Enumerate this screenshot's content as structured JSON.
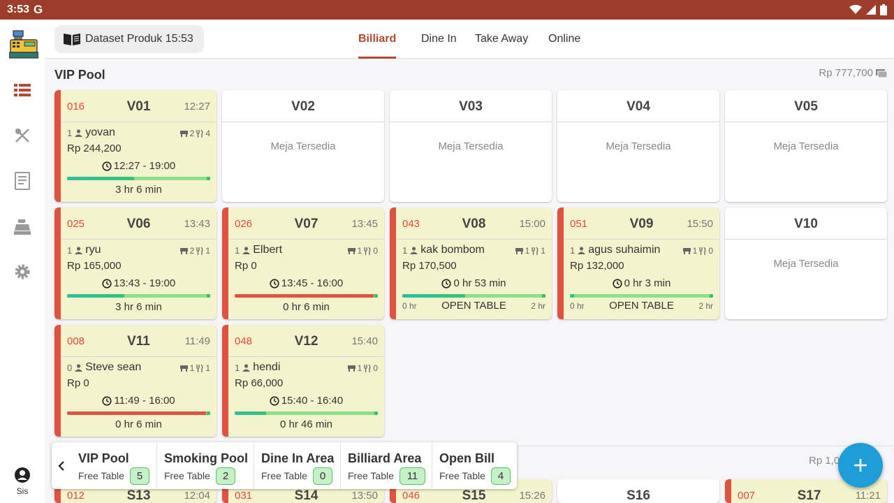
{
  "status_bar": {
    "time": "3:53",
    "g_icon": "G"
  },
  "sidebar": {
    "items": [
      {
        "icon": "list-icon"
      },
      {
        "icon": "utensils-icon"
      },
      {
        "icon": "receipt-icon"
      },
      {
        "icon": "cash-register-icon"
      },
      {
        "icon": "gear-icon"
      }
    ],
    "user_label": "Sis"
  },
  "topbar": {
    "dataset_label": "Dataset Produk 15:53",
    "tabs": [
      "Billiard",
      "Dine In",
      "Take Away",
      "Online"
    ],
    "active_tab": "Billiard"
  },
  "vip": {
    "title": "VIP Pool",
    "total": "Rp 777,700",
    "tables": [
      {
        "name": "V01",
        "bill": "016",
        "start": "12:27",
        "guests": "1",
        "customer": "yovan",
        "tables_count": "2",
        "items": "4",
        "amount": "Rp 244,200",
        "period": "12:27 - 19:00",
        "duration": "3 hr 6 min",
        "progress": 0.47
      },
      {
        "name": "V02",
        "available": "Meja Tersedia"
      },
      {
        "name": "V03",
        "available": "Meja Tersedia"
      },
      {
        "name": "V04",
        "available": "Meja Tersedia"
      },
      {
        "name": "V05",
        "available": "Meja Tersedia"
      },
      {
        "name": "V06",
        "bill": "025",
        "start": "13:43",
        "guests": "1",
        "customer": "ryu",
        "tables_count": "2",
        "items": "1",
        "amount": "Rp 165,000",
        "period": "13:43 - 19:00",
        "duration": "3 hr 6 min",
        "progress": 0.4
      },
      {
        "name": "V07",
        "bill": "026",
        "start": "13:45",
        "guests": "1",
        "customer": "Elbert",
        "tables_count": "1",
        "items": "0",
        "amount": "Rp 0",
        "period": "13:45 - 16:00",
        "duration": "0 hr 6 min",
        "progress": 0.97
      },
      {
        "name": "V08",
        "bill": "043",
        "start": "15:00",
        "guests": "1",
        "customer": "kak bombom",
        "tables_count": "1",
        "items": "1",
        "amount": "Rp 170,500",
        "period": "0 hr 53 min",
        "open": "OPEN TABLE",
        "open_min": "0 hr",
        "open_max": "2 hr",
        "progress": 0.44
      },
      {
        "name": "V09",
        "bill": "051",
        "start": "15:50",
        "guests": "1",
        "customer": "agus suhaimin",
        "tables_count": "1",
        "items": "0",
        "amount": "Rp 132,000",
        "period": "0 hr 3 min",
        "open": "OPEN TABLE",
        "open_min": "0 hr",
        "open_max": "2 hr",
        "progress": 0.03
      },
      {
        "name": "V10",
        "available": "Meja Tersedia"
      },
      {
        "name": "V11",
        "bill": "008",
        "start": "11:49",
        "guests": "0",
        "customer": "Steve sean",
        "tables_count": "1",
        "items": "1",
        "amount": "Rp 0",
        "period": "11:49 - 16:00",
        "duration": "0 hr 6 min",
        "progress": 0.97
      },
      {
        "name": "V12",
        "bill": "048",
        "start": "15:40",
        "guests": "1",
        "customer": "hendi",
        "tables_count": "1",
        "items": "0",
        "amount": "Rp 66,000",
        "period": "15:40 - 16:40",
        "duration": "0 hr 46 min",
        "progress": 0.22
      }
    ]
  },
  "smoking": {
    "total": "Rp 1,0",
    "tables": [
      {
        "name": "S13",
        "bill": "012",
        "start": "12:04"
      },
      {
        "name": "S14",
        "bill": "031",
        "start": "13:50"
      },
      {
        "name": "S15",
        "bill": "046",
        "start": "15:26"
      },
      {
        "name": "S16"
      },
      {
        "name": "S17",
        "bill": "007",
        "start": "11:21"
      }
    ]
  },
  "bottom_nav": {
    "free_label": "Free Table",
    "areas": [
      {
        "name": "VIP Pool",
        "free": "5"
      },
      {
        "name": "Smoking Pool",
        "free": "2"
      },
      {
        "name": "Dine In Area",
        "free": "0"
      },
      {
        "name": "Billiard Area",
        "free": "11"
      },
      {
        "name": "Open Bill",
        "free": "4"
      }
    ]
  },
  "colors": {
    "primary": "#9b3d2a",
    "accent": "#b24a33",
    "occupied_card": "#f4f3cd",
    "fab": "#1e9ed8",
    "bar_green": "#8de08a",
    "bar_red": "#e05242"
  }
}
